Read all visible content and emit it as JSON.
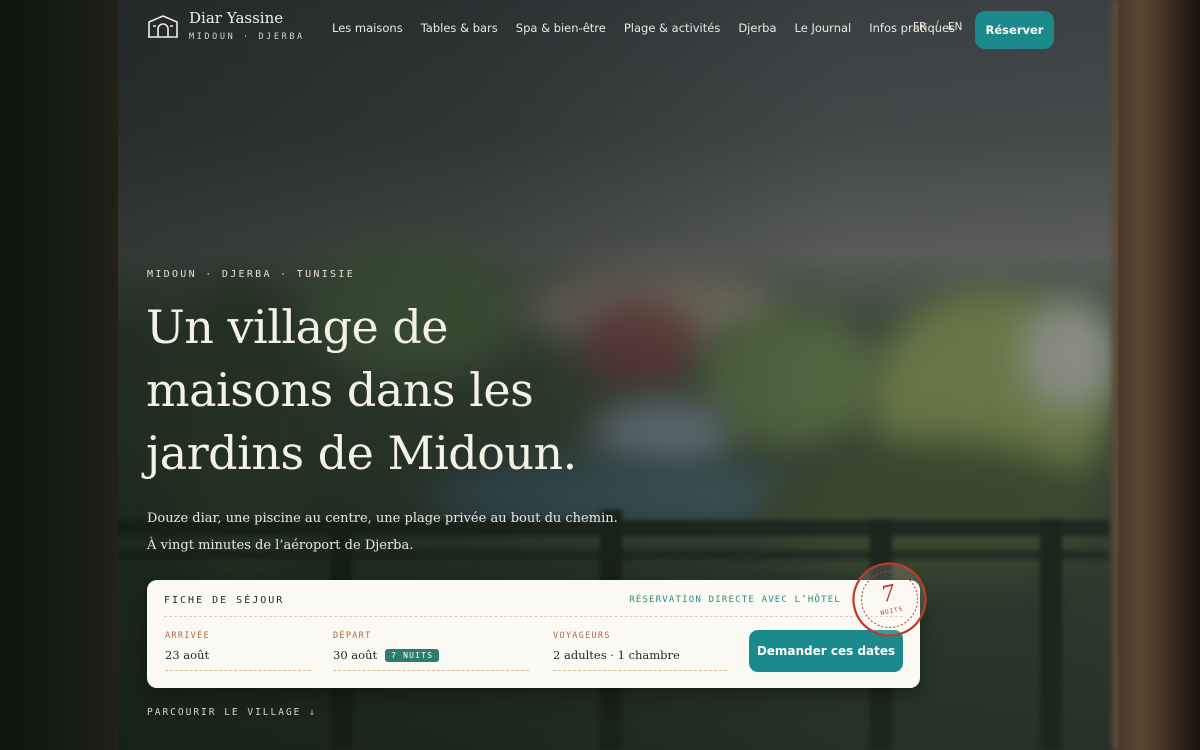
{
  "brand": {
    "name": "Diar Yassine",
    "subtitle": "MIDOUN · DJERBA",
    "icon": "house-arch-icon"
  },
  "nav": {
    "items": [
      "Les maisons",
      "Tables & bars",
      "Spa & bien-être",
      "Plage & activités",
      "Djerba",
      "Le Journal",
      "Infos pratiques"
    ]
  },
  "lang": {
    "fr": "FR",
    "separator": "/",
    "en": "EN"
  },
  "header": {
    "reserve_label": "Réserver"
  },
  "hero": {
    "eyebrow": "MIDOUN · DJERBA · TUNISIE",
    "title_lines": [
      "Un village de",
      "maisons dans les",
      "jardins de Midoun."
    ],
    "subtitle_lines": [
      "Douze diar, une piscine au centre, une plage privée au bout du chemin.",
      "À vingt minutes de l’aéroport de Djerba."
    ]
  },
  "booking": {
    "title": "FICHE DE SÉJOUR",
    "note": "RÉSERVATION DIRECTE AVEC L’HÔTEL",
    "arrival": {
      "label": "ARRIVÉE",
      "value": "23 août"
    },
    "departure": {
      "label": "DÉPART",
      "value": "30 août",
      "nights_badge": "7 NUITS"
    },
    "guests": {
      "label": "VOYAGEURS",
      "value": "2 adultes · 1 chambre"
    },
    "submit_label": "Demander ces dates"
  },
  "stamp": {
    "number": "7",
    "word": "NUITS"
  },
  "scroll_hint": "PARCOURIR LE VILLAGE ↓",
  "colors": {
    "accent": "#1b8a8d",
    "badge": "#2d7d6b",
    "label": "#b36a3e",
    "stamp": "#c0392b",
    "card": "#fbf9f4"
  }
}
